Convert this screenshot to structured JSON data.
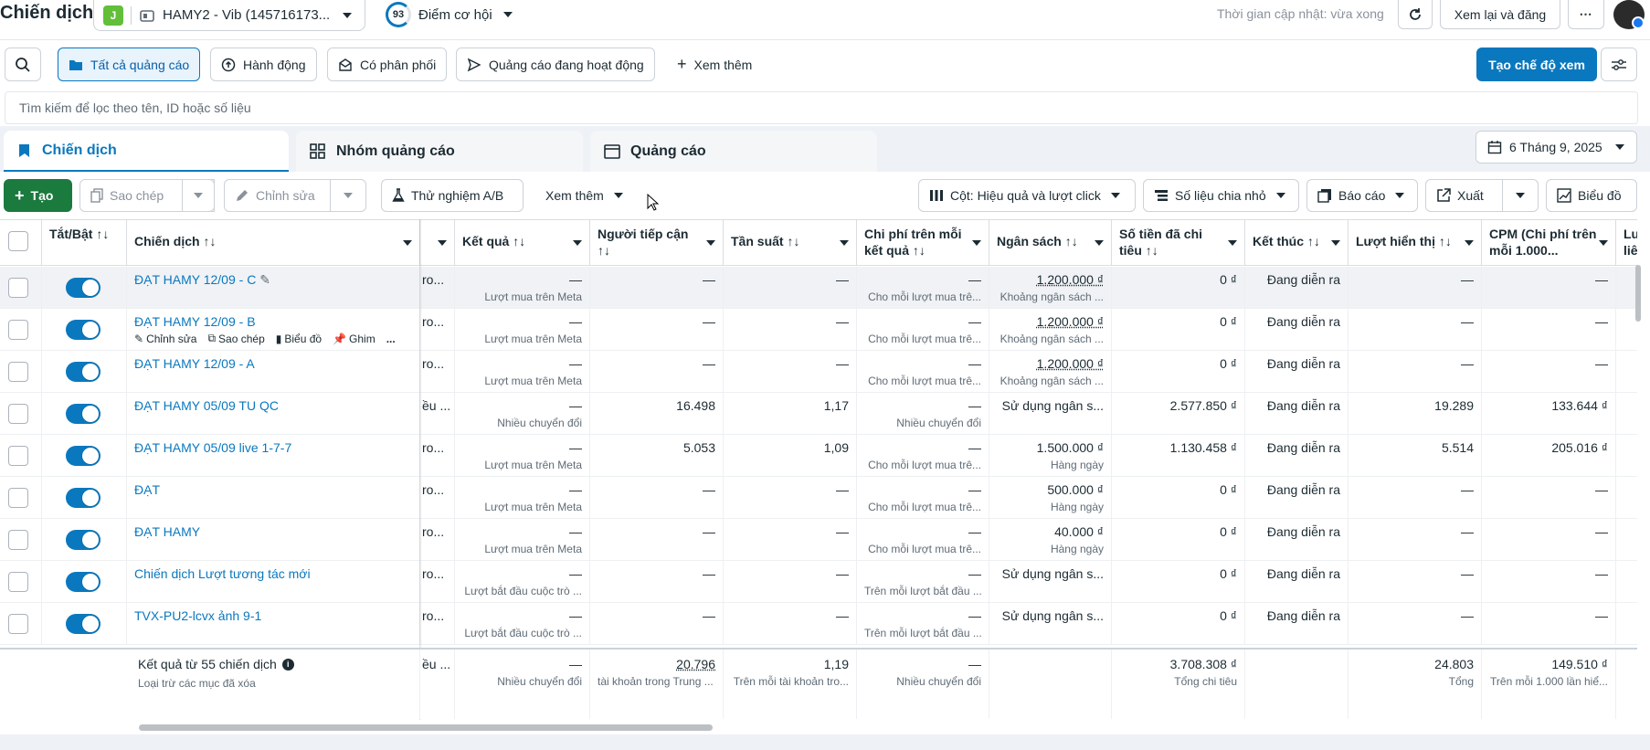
{
  "header": {
    "page_title": "Chiến dịch",
    "account_badge": "J",
    "account_name": "HAMY2 - Vib (145716173...",
    "score_value": "93",
    "score_label": "Điểm cơ hội",
    "update_text": "Thời gian cập nhật: vừa xong",
    "review_publish": "Xem lại và đăng"
  },
  "filters": {
    "all_ads": "Tất cả quảng cáo",
    "actions": "Hành động",
    "delivery": "Có phân phối",
    "active_ads": "Quảng cáo đang hoạt động",
    "more": "Xem thêm",
    "create_view": "Tạo chế độ xem",
    "search_placeholder": "Tìm kiếm để lọc theo tên, ID hoặc số liệu"
  },
  "tabs": {
    "campaigns": "Chiến dịch",
    "adsets": "Nhóm quảng cáo",
    "ads": "Quảng cáo",
    "date": "6 Tháng 9, 2025"
  },
  "toolbar": {
    "create": "Tạo",
    "duplicate": "Sao chép",
    "edit": "Chỉnh sửa",
    "ab_test": "Thử nghiệm A/B",
    "see_more": "Xem thêm",
    "columns": "Cột: Hiệu quả và lượt click",
    "breakdown": "Số liệu chia nhỏ",
    "reports": "Báo cáo",
    "export": "Xuất",
    "charts": "Biểu đồ"
  },
  "headers": {
    "toggle": "Tắt/Bật ↑↓",
    "campaign": "Chiến dịch ↑↓",
    "results": "Kết quả ↑↓",
    "reach": "Người tiếp cận ↑↓",
    "frequency": "Tần suất ↑↓",
    "cpr": "Chi phí trên mỗi kết quả ↑↓",
    "budget": "Ngân sách ↑↓",
    "spent": "Số tiền đã chi tiêu ↑↓",
    "end": "Kết thúc ↑↓",
    "impressions": "Lượt hiển thị ↑↓",
    "cpm": "CPM (Chi phí trên mỗi 1.000...",
    "next": "Lư liên"
  },
  "hover_actions": {
    "edit": "Chỉnh sửa",
    "duplicate": "Sao chép",
    "chart": "Biểu đồ",
    "pin": "Ghim",
    "more": "..."
  },
  "rows": [
    {
      "name": "ĐẠT HAMY 12/09 - C",
      "partial": "ro...",
      "result": "—",
      "result_sub": "Lượt mua trên Meta",
      "reach": "—",
      "freq": "—",
      "cpr": "—",
      "cpr_sub": "Cho mỗi lượt mua trê...",
      "budget": "1.200.000 ₫",
      "budget_sub": "Khoảng ngân sách ...",
      "spent": "0 ₫",
      "end": "Đang diễn ra",
      "impr": "—",
      "cpm": "—"
    },
    {
      "name": "ĐẠT HAMY 12/09 - B",
      "partial": "ro...",
      "result": "—",
      "result_sub": "Lượt mua trên Meta",
      "reach": "—",
      "freq": "—",
      "cpr": "—",
      "cpr_sub": "Cho mỗi lượt mua trê...",
      "budget": "1.200.000 ₫",
      "budget_sub": "Khoảng ngân sách ...",
      "spent": "0 ₫",
      "end": "Đang diễn ra",
      "impr": "—",
      "cpm": "—"
    },
    {
      "name": "ĐẠT HAMY 12/09 - A",
      "partial": "ro...",
      "result": "—",
      "result_sub": "Lượt mua trên Meta",
      "reach": "—",
      "freq": "—",
      "cpr": "—",
      "cpr_sub": "Cho mỗi lượt mua trê...",
      "budget": "1.200.000 ₫",
      "budget_sub": "Khoảng ngân sách ...",
      "spent": "0 ₫",
      "end": "Đang diễn ra",
      "impr": "—",
      "cpm": "—"
    },
    {
      "name": "ĐẠT HAMY 05/09 TU QC",
      "partial": "ều ...",
      "result": "—",
      "result_sub": "Nhiều chuyển đổi",
      "reach": "16.498",
      "freq": "1,17",
      "cpr": "—",
      "cpr_sub": "Nhiều chuyển đổi",
      "budget": "Sử dụng ngân s...",
      "budget_sub": "",
      "spent": "2.577.850 ₫",
      "end": "Đang diễn ra",
      "impr": "19.289",
      "cpm": "133.644 ₫"
    },
    {
      "name": "ĐẠT HAMY 05/09 live 1-7-7",
      "partial": "ro...",
      "result": "—",
      "result_sub": "Lượt mua trên Meta",
      "reach": "5.053",
      "freq": "1,09",
      "cpr": "—",
      "cpr_sub": "Cho mỗi lượt mua trê...",
      "budget": "1.500.000 ₫",
      "budget_sub": "Hàng ngày",
      "spent": "1.130.458 ₫",
      "end": "Đang diễn ra",
      "impr": "5.514",
      "cpm": "205.016 ₫"
    },
    {
      "name": "ĐẠT",
      "partial": "ro...",
      "result": "—",
      "result_sub": "Lượt mua trên Meta",
      "reach": "—",
      "freq": "—",
      "cpr": "—",
      "cpr_sub": "Cho mỗi lượt mua trê...",
      "budget": "500.000 ₫",
      "budget_sub": "Hàng ngày",
      "spent": "0 ₫",
      "end": "Đang diễn ra",
      "impr": "—",
      "cpm": "—"
    },
    {
      "name": "ĐẠT HAMY",
      "partial": "ro...",
      "result": "—",
      "result_sub": "Lượt mua trên Meta",
      "reach": "—",
      "freq": "—",
      "cpr": "—",
      "cpr_sub": "Cho mỗi lượt mua trê...",
      "budget": "40.000 ₫",
      "budget_sub": "Hàng ngày",
      "spent": "0 ₫",
      "end": "Đang diễn ra",
      "impr": "—",
      "cpm": "—"
    },
    {
      "name": "Chiến dịch Lượt tương tác mới",
      "partial": "ro...",
      "result": "—",
      "result_sub": "Lượt bắt đầu cuộc trò ...",
      "reach": "—",
      "freq": "—",
      "cpr": "—",
      "cpr_sub": "Trên mỗi lượt bắt đầu ...",
      "budget": "Sử dụng ngân s...",
      "budget_sub": "",
      "spent": "0 ₫",
      "end": "Đang diễn ra",
      "impr": "—",
      "cpm": "—"
    },
    {
      "name": "TVX-PU2-lcvx ảnh 9-1",
      "partial": "ro...",
      "result": "—",
      "result_sub": "Lượt bắt đầu cuộc trò ...",
      "reach": "—",
      "freq": "—",
      "cpr": "—",
      "cpr_sub": "Trên mỗi lượt bắt đầu ...",
      "budget": "Sử dụng ngân s...",
      "budget_sub": "",
      "spent": "0 ₫",
      "end": "Đang diễn ra",
      "impr": "—",
      "cpm": "—"
    }
  ],
  "footer": {
    "title": "Kết quả từ 55 chiến dịch",
    "subtitle": "Loại trừ các mục đã xóa",
    "partial": "ều ...",
    "result": "—",
    "result_sub": "Nhiều chuyển đổi",
    "reach": "20.796",
    "reach_sub": "tài khoản trong Trung ...",
    "freq": "1,19",
    "freq_sub": "Trên mỗi tài khoản tro...",
    "cpr": "—",
    "cpr_sub": "Nhiều chuyển đổi",
    "spent": "3.708.308 ₫",
    "spent_sub": "Tổng chi tiêu",
    "impr": "24.803",
    "impr_sub": "Tổng",
    "cpm": "149.510 ₫",
    "cpm_sub": "Trên mỗi 1.000 lần hiể..."
  },
  "colors": {
    "accent": "#0a78be",
    "create": "#1b7a3e",
    "toggle_on": "#0a78be",
    "highlight_row": "#f0f2f5"
  }
}
